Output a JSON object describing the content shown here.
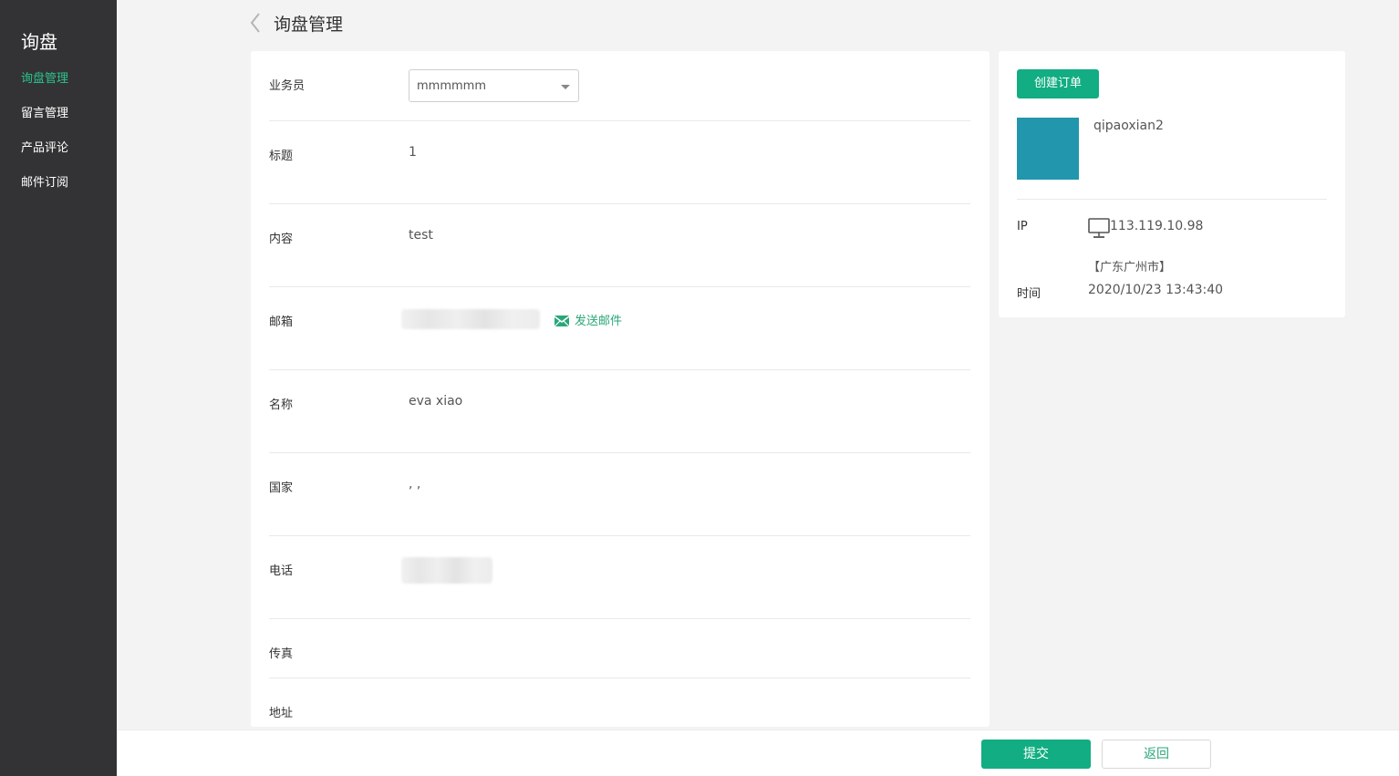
{
  "sidebar": {
    "title": "询盘",
    "items": [
      {
        "label": "询盘管理",
        "active": true
      },
      {
        "label": "留言管理",
        "active": false
      },
      {
        "label": "产品评论",
        "active": false
      },
      {
        "label": "邮件订阅",
        "active": false
      }
    ]
  },
  "header": {
    "title": "询盘管理"
  },
  "form": {
    "salesperson": {
      "label": "业务员",
      "value": "mmmmmm"
    },
    "title": {
      "label": "标题",
      "value": "1"
    },
    "content": {
      "label": "内容",
      "value": "test"
    },
    "email": {
      "label": "邮箱",
      "send_label": "发送邮件"
    },
    "name": {
      "label": "名称",
      "value": "eva xiao"
    },
    "country": {
      "label": "国家",
      "value": ", ,"
    },
    "phone": {
      "label": "电话"
    },
    "fax": {
      "label": "传真",
      "value": ""
    },
    "address": {
      "label": "地址",
      "value": ""
    }
  },
  "side": {
    "create_order_label": "创建订单",
    "username": "qipaoxian2",
    "ip_label": "IP",
    "ip_value": "113.119.10.98",
    "location": "【广东广州市】",
    "time_label": "时间",
    "time_value": "2020/10/23 13:43:40",
    "avatar_color": "#2196ad"
  },
  "footer": {
    "submit_label": "提交",
    "back_label": "返回"
  },
  "colors": {
    "accent": "#12ad82",
    "sidebar_bg": "#333335",
    "active_nav": "#2bc58d"
  }
}
